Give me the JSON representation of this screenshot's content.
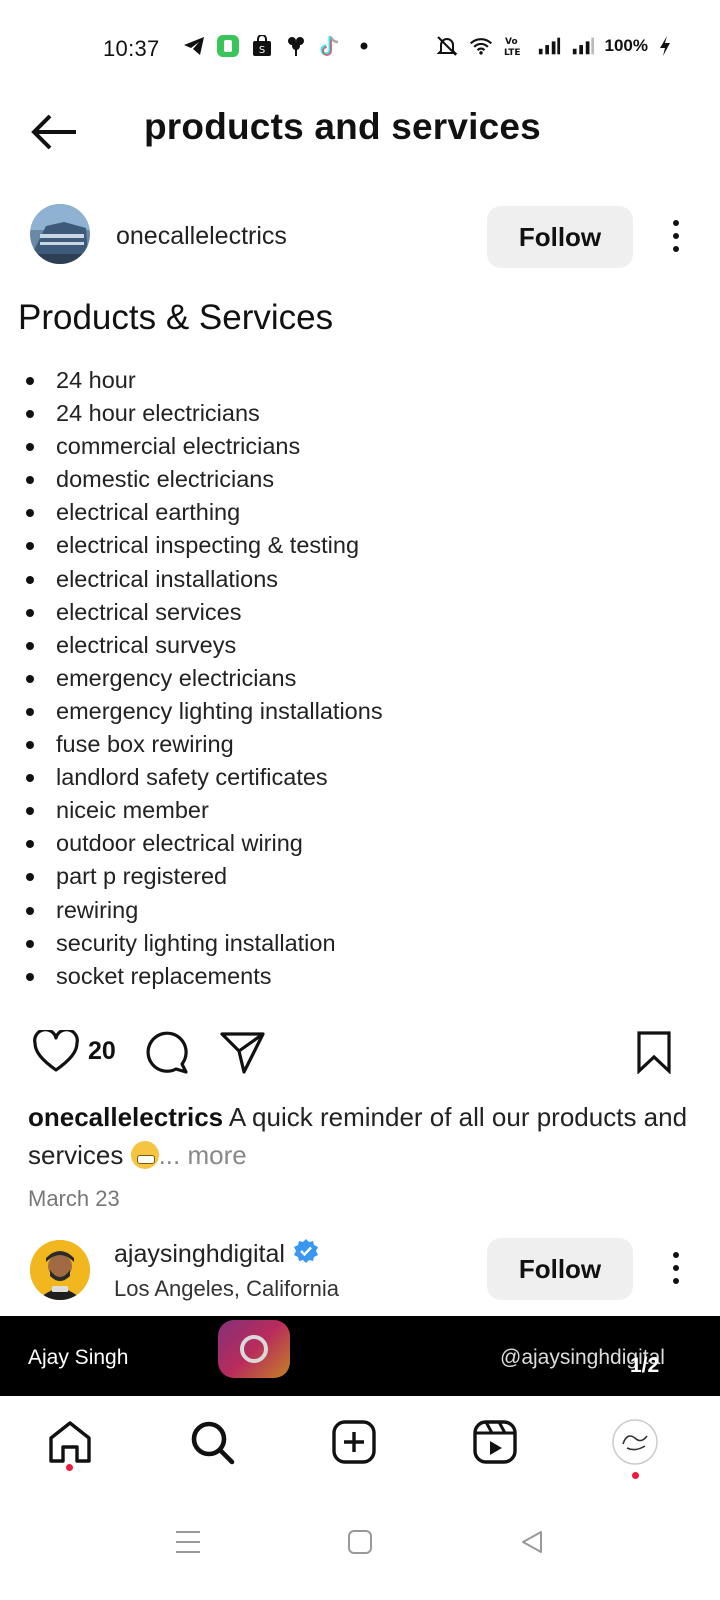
{
  "status_bar": {
    "time": "10:37",
    "battery": "100%",
    "left_icons": [
      "telegram-icon",
      "app-icon",
      "shopping-bag-icon",
      "flower-icon",
      "tiktok-icon",
      "dot-icon"
    ],
    "right_icons": [
      "mute-icon",
      "wifi-icon",
      "volte-icon",
      "signal-icon",
      "signal-icon",
      "charging-icon"
    ]
  },
  "header": {
    "title": "products and services"
  },
  "post": {
    "username": "onecallelectrics",
    "follow_label": "Follow",
    "image": {
      "heading": "Products & Services",
      "items": [
        "24 hour",
        "24 hour electricians",
        "commercial electricians",
        "domestic electricians",
        "electrical earthing",
        "electrical inspecting & testing",
        "electrical installations",
        "electrical services",
        "electrical surveys",
        "emergency electricians",
        "emergency lighting installations",
        "fuse box rewiring",
        "landlord safety certificates",
        "niceic member",
        "outdoor electrical wiring",
        "part p registered",
        "rewiring",
        "security lighting installation",
        "socket replacements"
      ]
    },
    "likes": "20",
    "caption_user": "onecallelectrics",
    "caption_text": " A quick reminder of all our products and services ",
    "caption_more": "... more",
    "date": "March 23"
  },
  "post2": {
    "username": "ajaysinghdigital",
    "location": "Los Angeles, California",
    "follow_label": "Follow",
    "verified": true
  },
  "banner": {
    "left_text": "Ajay Singh",
    "right_text": "@ajaysinghdigital",
    "counter": "1/2"
  },
  "colors": {
    "follow_bg": "#efefef",
    "notification_dot": "#ec1b3e",
    "verified_blue": "#3897f0"
  },
  "bottom_nav": [
    "home-icon",
    "search-icon",
    "create-icon",
    "reels-icon",
    "profile-avatar"
  ]
}
